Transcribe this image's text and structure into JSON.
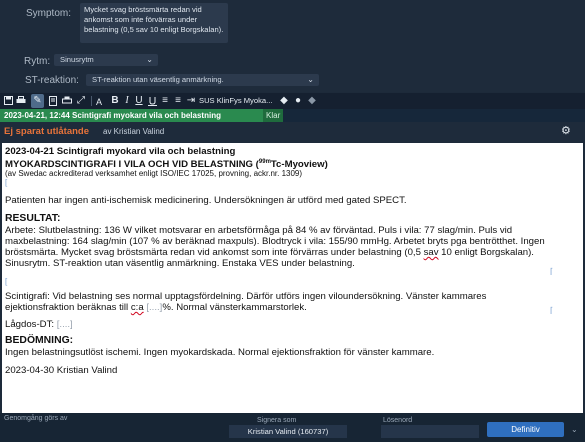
{
  "form": {
    "symptom_label": "Symptom:",
    "symptom_text": "Mycket svag bröstsmärta redan vid ankomst som inte förvärras under belastning (0,5 sav 10 enligt Borgskalan).",
    "rytm_label": "Rytm:",
    "rytm_value": "Sinusrytm",
    "st_label": "ST-reaktion:",
    "st_value": "ST-reaktion utan väsentlig anmärkning."
  },
  "toolbar": {
    "bold": "B",
    "italic": "I",
    "underline": "U",
    "phrase_select": "SUS KlinFys Myoka..."
  },
  "tab": {
    "title": "2023-04-21, 12:44  Scintigrafi myokard vila och belastning",
    "status": "Klar"
  },
  "status": {
    "unsaved": "Ej sparat utlåtande",
    "by": "av Kristian Valind"
  },
  "doc": {
    "l1": "2023-04-21 Scintigrafi myokard vila och belastning",
    "l2a": "MYOKARDSCINTIGRAFI I VILA OCH VID BELASTNING (",
    "l2sup": "99m",
    "l2b": "Tc-Myoview)",
    "l3": "(av Swedac ackrediterad verksamhet enligt ISO/IEC 17025, provning, ackr.nr. 1309)",
    "l4": "Patienten har ingen anti-ischemisk medicinering. Undersökningen är utförd med gated SPECT.",
    "l5": "RESULTAT:",
    "l6": "Arbete: Slutbelastning: 136 W vilket motsvarar en arbetsförmåga på 84 % av förväntad. Puls i vila: 77 slag/min. Puls vid",
    "l7": "maxbelastning: 164 slag/min (107 % av beräknad maxpuls). Blodtryck i vila: 155/90 mmHg. Arbetet bryts pga bentrötthet. Ingen",
    "l8a": "bröstsmärta. Mycket svag bröstsmärta redan vid ankomst som inte förvärras under belastning (0,5 ",
    "l8sq": "sav",
    "l8b": " 10 enligt Borgskalan).",
    "l9": "Sinusrytm. ST-reaktion utan väsentlig anmärkning. Enstaka VES under belastning.",
    "l10": "Scintigrafi: Vid belastning ses normal upptagsfördelning. Därför utförs ingen viloundersökning. Vänster kammares",
    "l11a": "ejektionsfraktion beräknas till ",
    "l11sq": "c:a",
    "l11field": "[....]",
    "l11b": "%. Normal vänsterkammarstorlek.",
    "l12": "Lågdos-DT:",
    "l12field": "[....]",
    "l13": "BEDÖMNING:",
    "l14": "Ingen belastningsutlöst ischemi. Ingen myokardskada. Normal ejektionsfraktion för vänster kammare.",
    "l15": "2023-04-30 Kristian Valind"
  },
  "footer": {
    "review_label": "Genomgång görs av",
    "sign_label": "Signera som",
    "sign_value": "Kristian Valind (160737)",
    "password_label": "Lösenord",
    "definitive_button": "Definitiv"
  },
  "colors": {
    "tab_green": "#2a8a4f",
    "unsaved_orange": "#e8733a",
    "button_blue": "#2f6fbf"
  }
}
